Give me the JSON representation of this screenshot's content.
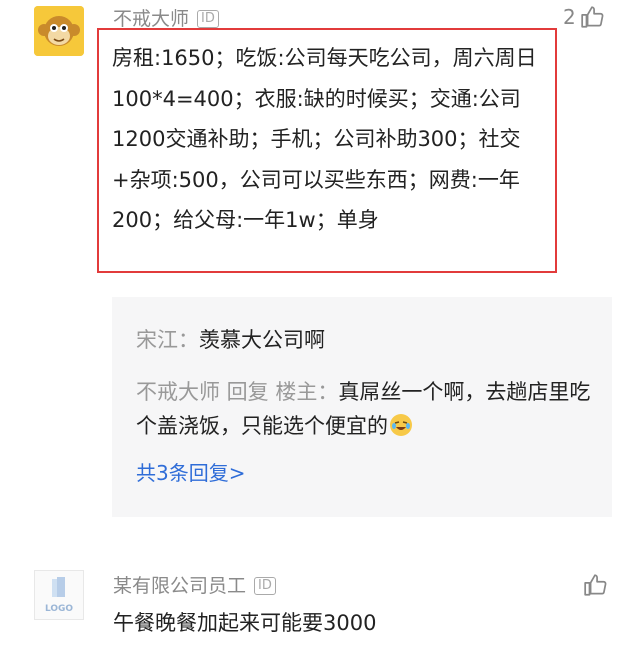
{
  "comment1": {
    "username": "不戒大师",
    "id_badge": "ID",
    "like_count": "2",
    "avatar_icon": "monkey-face-icon",
    "text": "房租:1650；吃饭:公司每天吃公司，周六周日100*4=400；衣服:缺的时候买；交通:公司1200交通补助；手机；公司补助300；社交+杂项:500，公司可以买些东西；网费:一年200；给父母:一年1w；单身",
    "highlight_color": "#e23b3b"
  },
  "replies": {
    "items": [
      {
        "who": "宋江：",
        "text": "羡慕大公司啊"
      },
      {
        "who": "不戒大师 回复 楼主：",
        "text": "真屌丝一个啊，去趟店里吃个盖浇饭，只能选个便宜的"
      }
    ],
    "more": "共3条回复>",
    "link_color": "#2f6dd8"
  },
  "comment2": {
    "username": "某有限公司员工",
    "id_badge": "ID",
    "avatar_icon": "logo-placeholder-icon",
    "avatar_text": "LOGO",
    "text": "午餐晚餐加起来可能要3000"
  }
}
